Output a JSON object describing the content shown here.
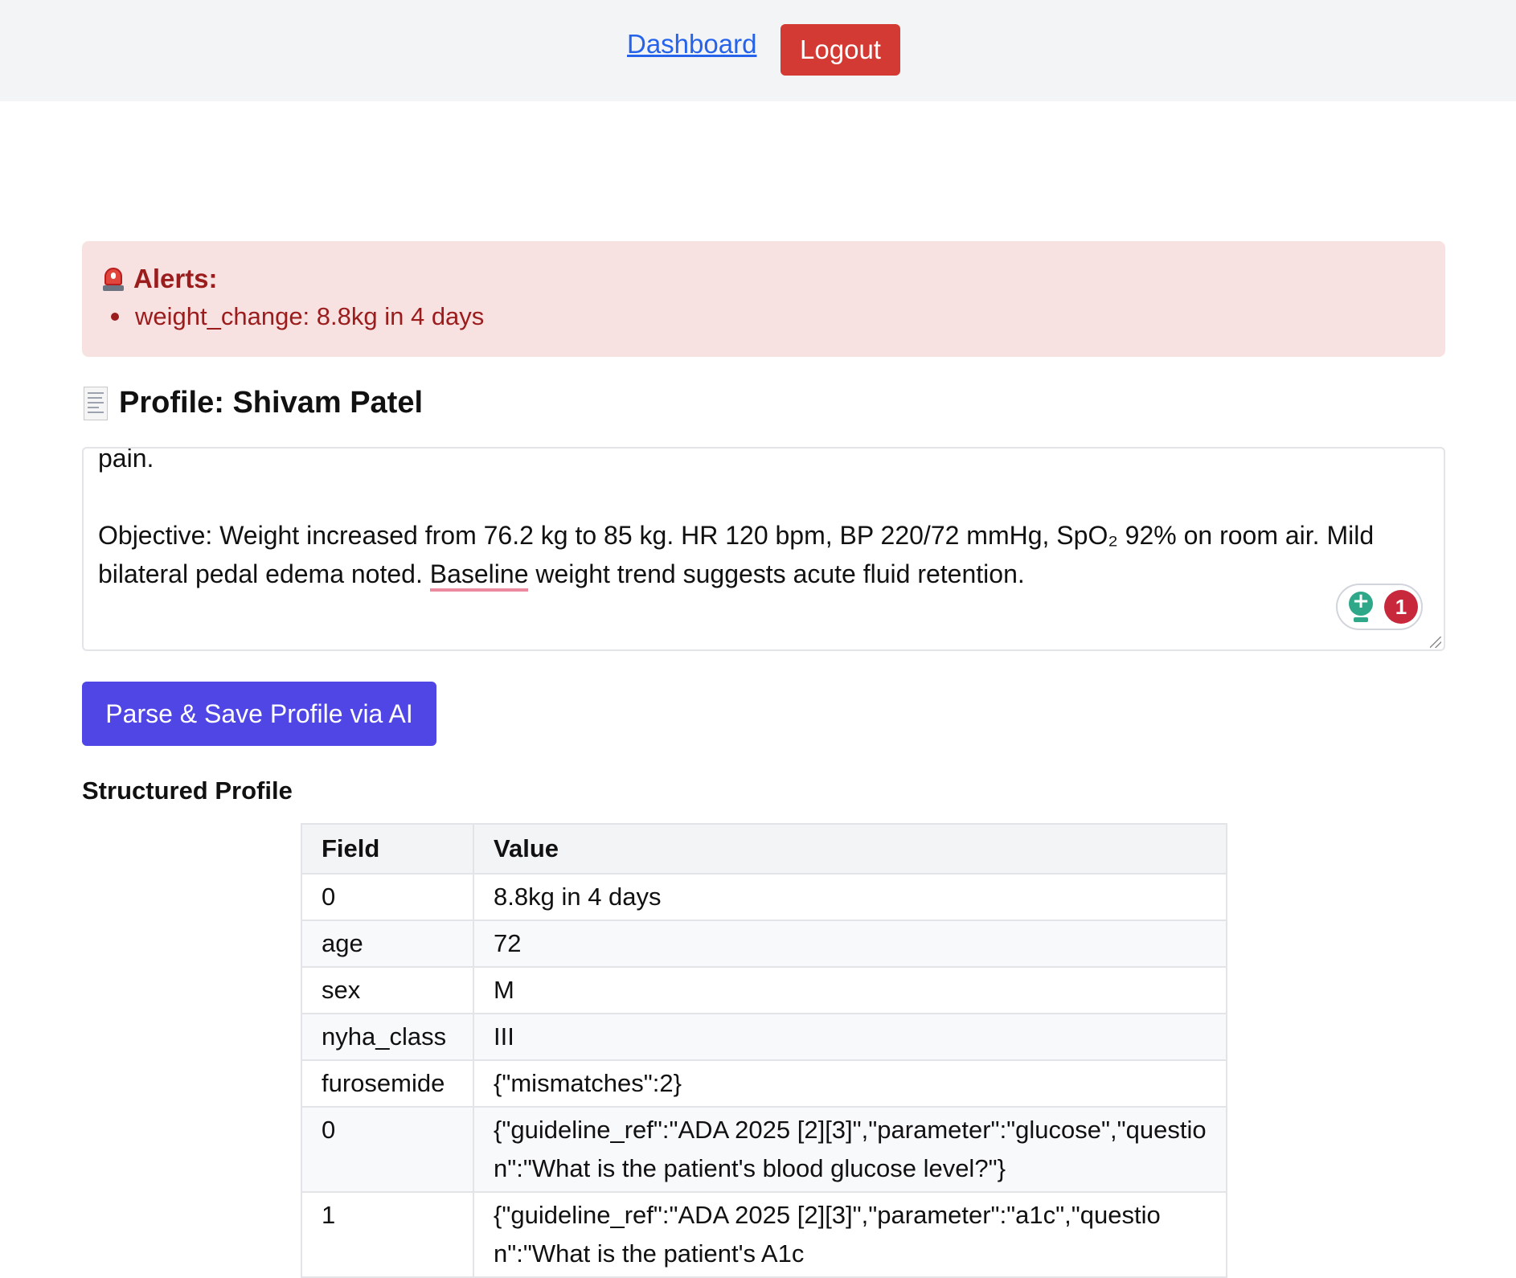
{
  "nav": {
    "dashboard_label": "Dashboard",
    "logout_label": "Logout"
  },
  "alerts": {
    "title": "Alerts:",
    "icon": "siren-icon",
    "items": [
      "weight_change: 8.8kg in 4 days"
    ]
  },
  "profile": {
    "icon": "receipt-icon",
    "heading": "Profile: Shivam Patel",
    "notes_line1": "pain.",
    "notes_objective_a": "Objective: Weight increased from 76.2 kg to 85 kg. HR 120 bpm, BP 220/72 mmHg, SpO₂ 92% on room air. Mild bilateral pedal edema noted. ",
    "notes_flagged_word": "Baseline",
    "notes_objective_b": " weight trend suggests acute fluid retention.",
    "assistant_suggestion_count": "1",
    "parse_button_label": "Parse & Save Profile via AI"
  },
  "structured": {
    "title": "Structured Profile",
    "columns": [
      "Field",
      "Value"
    ],
    "rows": [
      {
        "field": "0",
        "value": "8.8kg in 4 days"
      },
      {
        "field": "age",
        "value": "72"
      },
      {
        "field": "sex",
        "value": "M"
      },
      {
        "field": "nyha_class",
        "value": "III"
      },
      {
        "field": "furosemide",
        "value": "{\"mismatches\":2}"
      },
      {
        "field": "0",
        "value": "{\"guideline_ref\":\"ADA 2025 [2][3]\",\"parameter\":\"glucose\",\"question\":\"What is the patient's blood glucose level?\"}"
      },
      {
        "field": "1",
        "value": "{\"guideline_ref\":\"ADA 2025 [2][3]\",\"parameter\":\"a1c\",\"question\":\"What is the patient's A1c"
      }
    ]
  },
  "colors": {
    "alert_bg": "#f8e1e1",
    "alert_text": "#9b1c1c",
    "primary_button": "#4f46e5",
    "logout_button": "#d23a33",
    "link": "#2563eb"
  }
}
